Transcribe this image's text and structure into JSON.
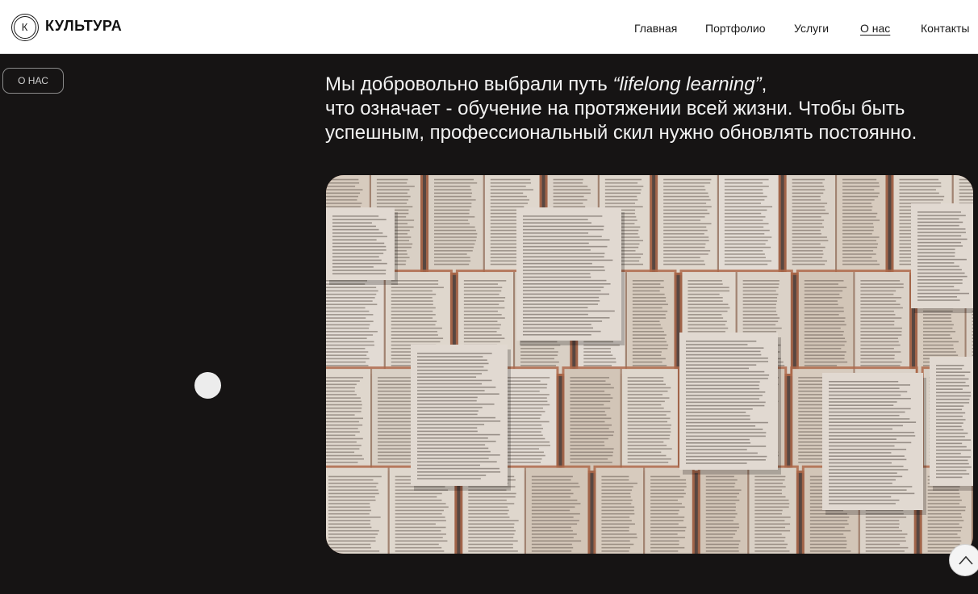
{
  "header": {
    "logo_letter": "К",
    "logo_text": "КУЛЬТУРА",
    "nav": [
      {
        "label": "Главная",
        "active": false
      },
      {
        "label": "Портфолио",
        "active": false
      },
      {
        "label": "Услуги",
        "active": false
      },
      {
        "label": "О нас",
        "active": true
      },
      {
        "label": "Контакты",
        "active": false
      }
    ]
  },
  "section": {
    "tag_label": "О НАС",
    "heading_line1_start": "Мы добровольно выбрали путь ",
    "heading_line1_italic": "“lifelong learning”",
    "heading_line1_end": ",",
    "heading_line2": "что означает - обучение на протяжении всей жизни. Чтобы быть",
    "heading_line3": "успешным, профессиональный скил нужно обновлять постоянно."
  },
  "colors": {
    "background": "#161414",
    "header_bg": "#ffffff",
    "text_light": "#f2f2f2"
  },
  "icons": {
    "scroll_top": "chevron-up-icon"
  }
}
